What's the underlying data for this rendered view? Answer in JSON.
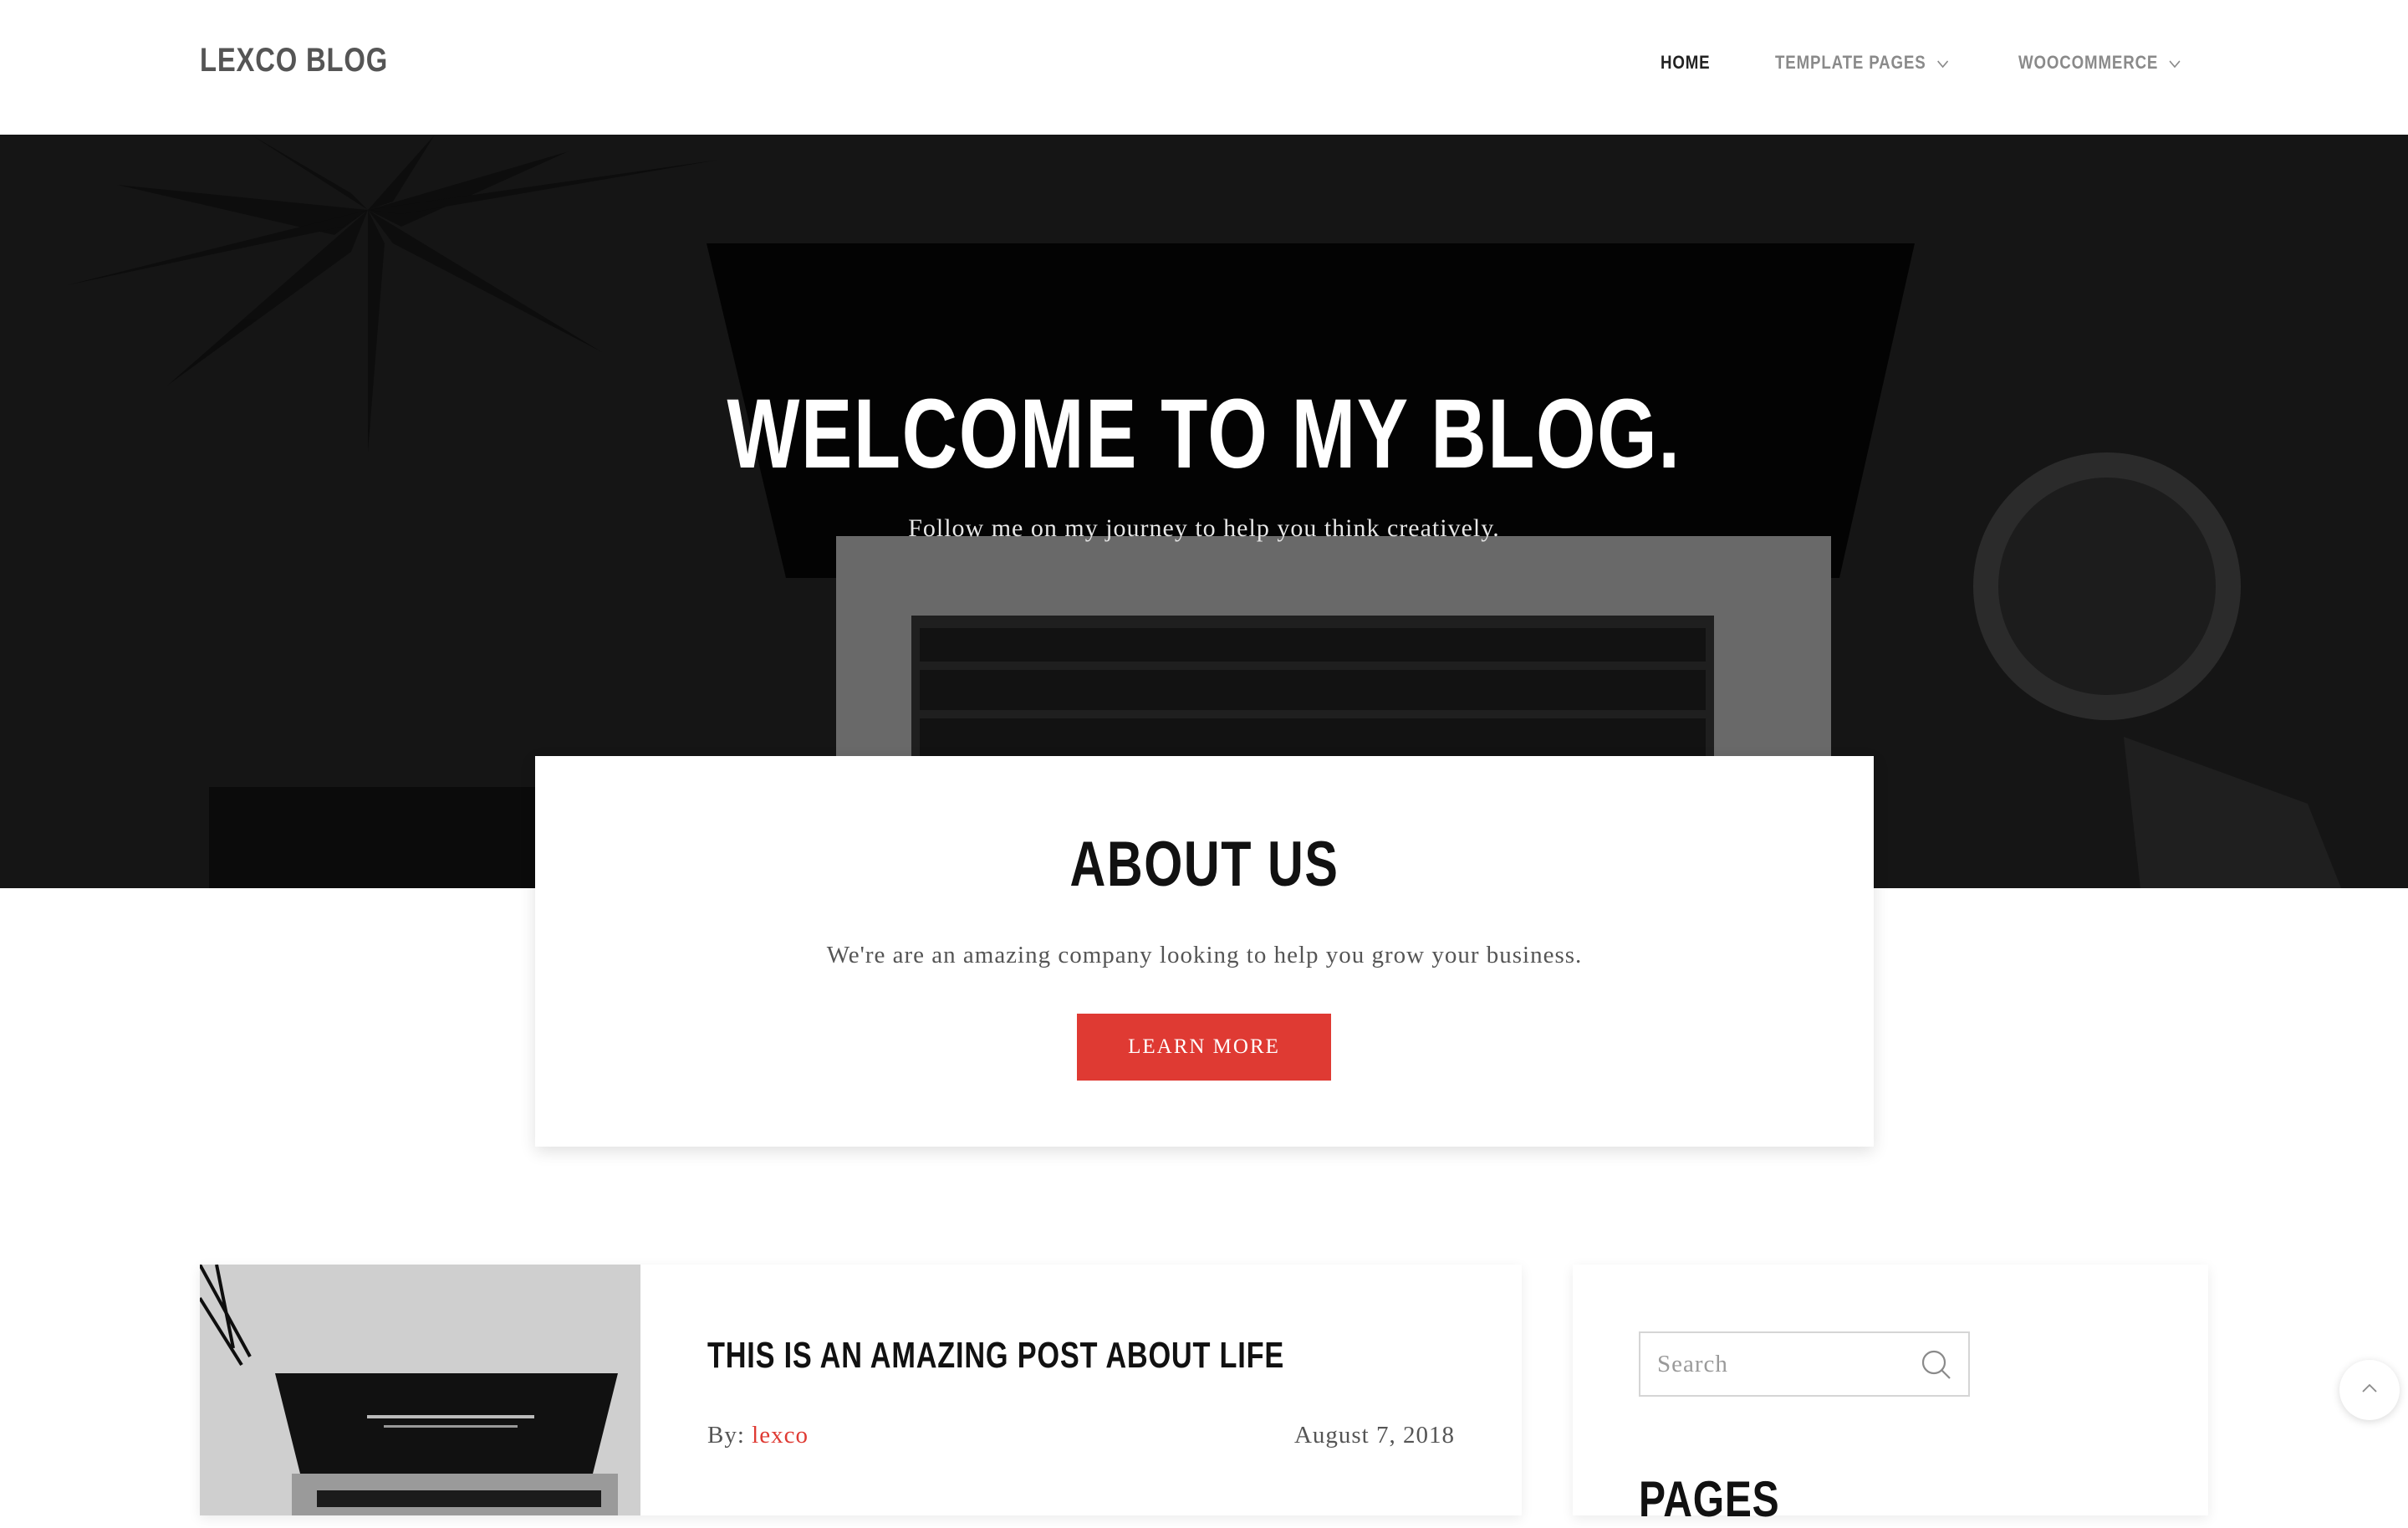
{
  "header": {
    "brand": "LEXCO BLOG",
    "nav": [
      {
        "label": "HOME",
        "active": true
      },
      {
        "label": "TEMPLATE PAGES",
        "icon": "chevron-down-icon"
      },
      {
        "label": "WOOCOMMERCE",
        "icon": "chevron-down-icon"
      }
    ]
  },
  "hero": {
    "title": "WELCOME TO MY BLOG.",
    "subtitle": "Follow me on my journey to help you think creatively."
  },
  "about": {
    "title": "ABOUT US",
    "text": "We're are an amazing company looking to help you grow your business.",
    "button_label": "LEARN MORE"
  },
  "post": {
    "title": "THIS IS AN AMAZING POST ABOUT LIFE",
    "by_label": "By:",
    "author": "lexco",
    "date": "August 7, 2018"
  },
  "sidebar": {
    "search_placeholder": "Search",
    "search_icon": "search-icon",
    "pages_title": "PAGES"
  },
  "scroll_top_icon": "chevron-up-icon",
  "colors": {
    "accent": "#df3a33",
    "hero_bg": "#1a1a1a",
    "text": "#555555"
  }
}
